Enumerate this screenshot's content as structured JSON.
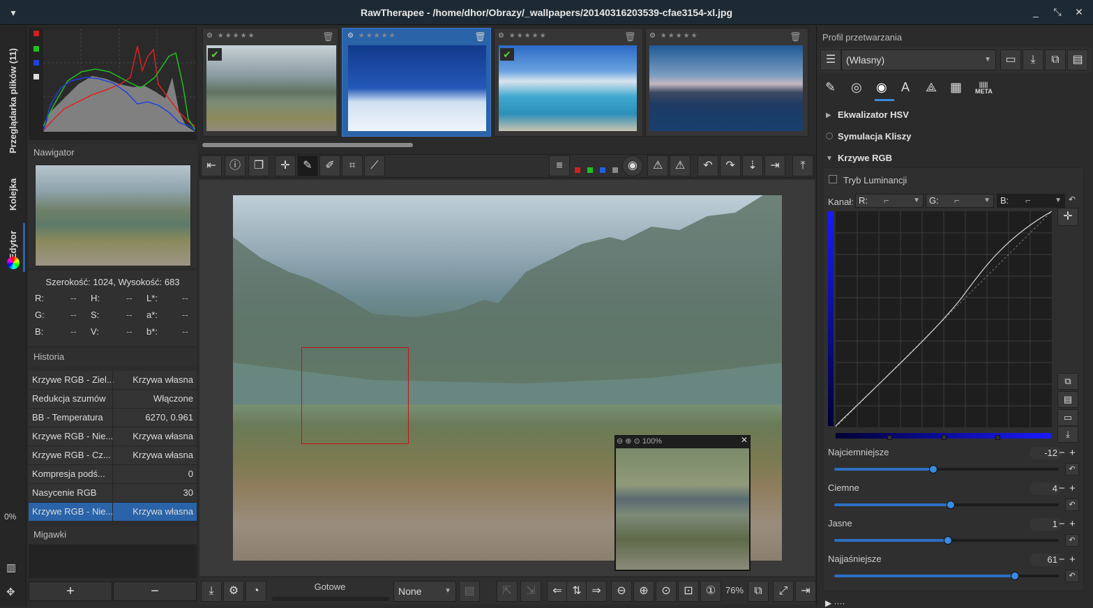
{
  "window": {
    "title": "RawTherapee  - /home/dhor/Obrazy/_wallpapers/20140316203539-cfae3154-xl.jpg",
    "menu_icon": "chevron-down-icon",
    "min": "_",
    "restore": "⤡",
    "close": "✕"
  },
  "vtabs": {
    "browser": "Przeglądarka plików (11)",
    "queue": "Kolejka",
    "editor": "Edytor",
    "progress": "0%"
  },
  "navigator": {
    "title": "Nawigator",
    "size": "Szerokość: 1024, Wysokość: 683",
    "rows": [
      [
        {
          "k": "R:",
          "v": "--"
        },
        {
          "k": "H:",
          "v": "--"
        },
        {
          "k": "L*:",
          "v": "--"
        }
      ],
      [
        {
          "k": "G:",
          "v": "--"
        },
        {
          "k": "S:",
          "v": "--"
        },
        {
          "k": "a*:",
          "v": "--"
        }
      ],
      [
        {
          "k": "B:",
          "v": "--"
        },
        {
          "k": "V:",
          "v": "--"
        },
        {
          "k": "b*:",
          "v": "--"
        }
      ]
    ]
  },
  "history": {
    "title": "Historia",
    "rows": [
      {
        "a": "Krzywe RGB - Ziel...",
        "b": "Krzywa własna"
      },
      {
        "a": "Redukcja szumów",
        "b": "Włączone"
      },
      {
        "a": "BB - Temperatura",
        "b": "6270, 0.961"
      },
      {
        "a": "Krzywe RGB - Nie...",
        "b": "Krzywa własna"
      },
      {
        "a": "Krzywe RGB - Cz...",
        "b": "Krzywa własna"
      },
      {
        "a": "Kompresja podś...",
        "b": "0"
      },
      {
        "a": "Nasycenie RGB",
        "b": "30"
      },
      {
        "a": "Krzywe RGB - Nie...",
        "b": "Krzywa własna"
      }
    ]
  },
  "snapshots": {
    "title": "Migawki",
    "add": "+",
    "remove": "−"
  },
  "filmstrip": {
    "stars": "★★★★★"
  },
  "statusbar": {
    "ready": "Gotowe",
    "select": "None",
    "zoom": "76%"
  },
  "preview": {
    "zoom": "100%"
  },
  "right": {
    "profile_title": "Profil przetwarzania",
    "profile_value": "(Własny)",
    "meta": "META",
    "tools": {
      "hsv": "Ekwalizator HSV",
      "film": "Symulacja Kliszy",
      "rgb": "Krzywe RGB"
    },
    "luminance": "Tryb Luminancji",
    "channel_label": "Kanał:",
    "channels": [
      "R:",
      "G:",
      "B:"
    ],
    "sliders": [
      {
        "label": "Najciemniejsze",
        "value": "-12",
        "pos": 0.44
      },
      {
        "label": "Ciemne",
        "value": "4",
        "pos": 0.52
      },
      {
        "label": "Jasne",
        "value": "1",
        "pos": 0.505
      },
      {
        "label": "Najjaśniejsze",
        "value": "61",
        "pos": 0.805
      }
    ]
  },
  "colors": {
    "accent": "#2a63a8",
    "slider": "#2c6fc2"
  }
}
